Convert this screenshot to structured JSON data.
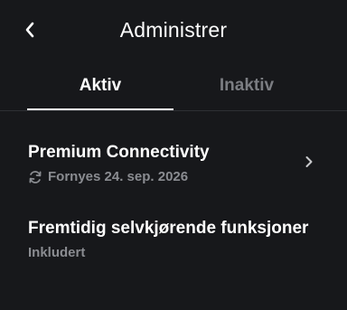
{
  "header": {
    "title": "Administrer",
    "back_icon": "chevron-left-icon"
  },
  "tabs": [
    {
      "label": "Aktiv",
      "active": true
    },
    {
      "label": "Inaktiv",
      "active": false
    }
  ],
  "subscriptions": [
    {
      "title": "Premium Connectivity",
      "subtitle": "Fornyes 24. sep. 2026",
      "icon": "refresh-icon",
      "has_chevron": true
    },
    {
      "title": "Fremtidig selvkjørende funksjoner",
      "subtitle": "Inkludert",
      "has_chevron": false
    }
  ],
  "colors": {
    "background": "#17181b",
    "primary_text": "#ffffff",
    "secondary_text": "#8a8c91",
    "inactive_tab": "#7b7d82",
    "divider": "#2e3034"
  }
}
